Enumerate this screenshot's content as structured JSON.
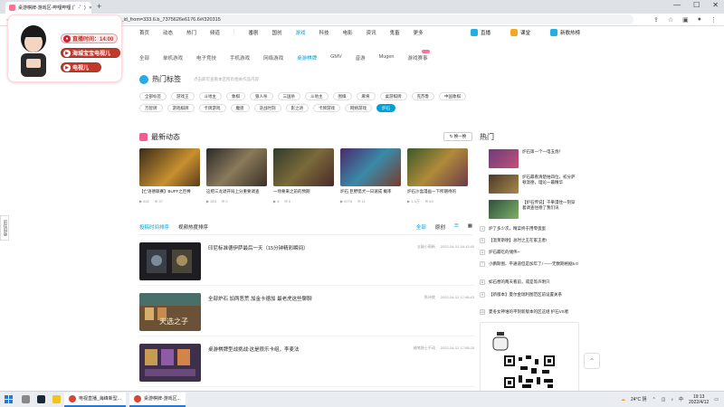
{
  "browser": {
    "tab_title": "桌游棋牌-游戏区-哔哩哔哩 (゜-゜)",
    "url": "bilibili.com/v/game/board/?spm_id_from=333.6.b_7375626e6176.6#/320315"
  },
  "webcam": {
    "badge_time": "直播时间：14:00",
    "badge_name1": "海城宝宝电视儿",
    "badge_name2": "电视儿"
  },
  "side_button": "前往旧版",
  "topnav": {
    "left": [
      "首页",
      "动态",
      "热门",
      "频道"
    ],
    "right": [
      "番剧",
      "国创",
      "游戏",
      "科技",
      "电影",
      "资讯",
      "鬼畜",
      "更多"
    ],
    "extras": [
      "直播",
      "课堂",
      "新歌热榜"
    ]
  },
  "subnav": [
    "全部",
    "单机游戏",
    "电子竞技",
    "手机游戏",
    "网络游戏",
    "桌游棋牌",
    "GMV",
    "音游",
    "Mugen",
    "游戏赛事"
  ],
  "hottags": {
    "title": "热门标签",
    "subtitle": "点击即可查看本区所有相关作品内容",
    "tags": [
      "全部标签",
      "游戏王",
      "斗地主",
      "象棋",
      "狼人杀",
      "三国杀",
      "斗地主",
      "围棋",
      "麻将",
      "桌游棋牌",
      "克苏鲁",
      "中国象棋",
      "万智牌",
      "游戏棋牌",
      "卡牌游戏",
      "魔兽",
      "逆战时刻",
      "影之诗",
      "卡牌游戏",
      "网络游戏",
      "炉石"
    ]
  },
  "recent": {
    "title": "最新动态",
    "refresh": "换一换",
    "cards": [
      {
        "title": "【亡语德联赛】BUFF之巨棒",
        "plays": "832",
        "comments": "37"
      },
      {
        "title": "这把三龙退开局上分重要调查",
        "plays": "283",
        "comments": "0"
      },
      {
        "title": "一场要来之前的预期",
        "plays": "8",
        "comments": "0"
      },
      {
        "title": "炉石 巨野猎犬一日速成 概率",
        "plays": "5776",
        "comments": "11"
      },
      {
        "title": "炉石沙盒漫画一下所期待的",
        "plays": "1.4万",
        "comments": "63"
      }
    ]
  },
  "feed": {
    "tabs": [
      "投稿时间排序",
      "视频热度排序"
    ],
    "right": [
      "全部",
      "原创"
    ],
    "items": [
      {
        "title": "印尼标准德伊萨最后一天（15分钟精彩瞬间）",
        "author": "",
        "up": "五级小萌新",
        "date": "2022-04-12 18:12:40"
      },
      {
        "title": "全部炉石 加两恶荒 加金卡德加 最老虎这些聊聊",
        "author": "",
        "up": "陈诗陵",
        "date": "2022-04-12 17:46:43"
      },
      {
        "title": "桌游棋牌型战挑战:这是很乐卡组，李麦法",
        "author": "",
        "up": "蜡笔隐士不动",
        "date": "2022-04-12 17:08:25"
      }
    ],
    "thumb_text": "天选之子"
  },
  "hot": {
    "title": "热门",
    "thumb_items": [
      "炉石第一个一电五炮！",
      "炉石最看清楚拍四位，初分萨顿温德，理论一最精华",
      "【炉石传说】干拳漫住一刻穿着调查住德了我们讯"
    ],
    "lines": [
      "炉了多少次，精菜终于用零蛋蛋",
      "【温莱斯德】总时之王在家王者!",
      "炉石最吃的储伟~",
      "小鹏斯图、平通道但是加年了! ——无数期格据5.0",
      "如石想的两天看前，或是等声明只",
      "【新版本】夏尔金瑞利图范区前设置关系",
      "夏冬女神谁的平刻新版本的区这组 护石VS者"
    ]
  },
  "taskbar": {
    "apps": [
      "电视直播_海峰新型...",
      "桌游棋牌-游戏区..."
    ],
    "weather": "24°C 阴",
    "time": "19:13",
    "date": "2022/4/12"
  },
  "colors": {
    "accent": "#00a1d6",
    "pink": "#fb7299",
    "badge_red": "#c0392b"
  }
}
